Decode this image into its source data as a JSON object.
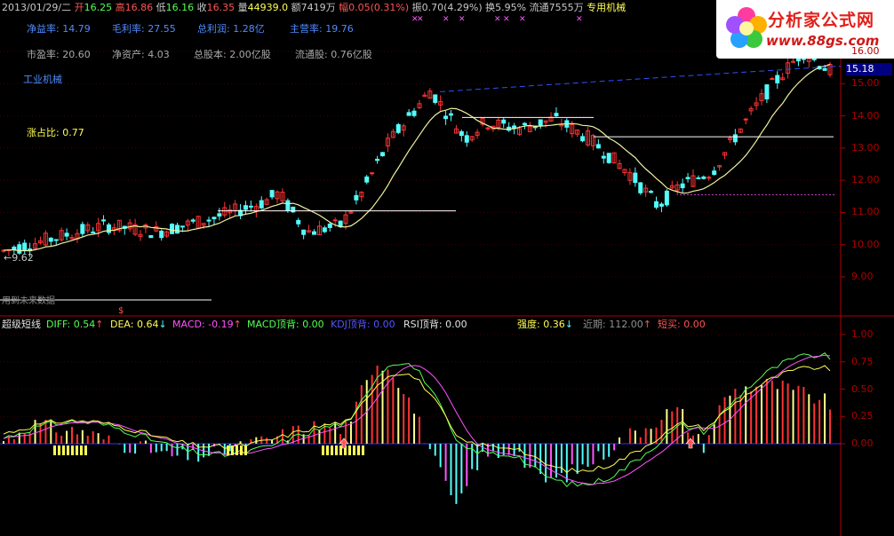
{
  "colors": {
    "up": "#ff3232",
    "down": "#54fcfc",
    "ma": "#f0f0a0",
    "axis": "#b00000",
    "label_white": "#c8c8c8",
    "label_blue": "#4f8cff",
    "label_yellow": "#ffff54",
    "label_red": "#ff5454",
    "label_green": "#54ff54",
    "label_magenta": "#ff54ff",
    "price_box": "#000080"
  },
  "header": {
    "date": "2013/01/29/二",
    "open_label": "开",
    "open": "16.25",
    "high_label": "高",
    "high": "16.86",
    "low_label": "低",
    "low": "16.16",
    "close_label": "收",
    "close": "16.35",
    "vol_label": "量",
    "vol": "44939.0",
    "amt_label": "额",
    "amt": "7419万",
    "chg_label": "幅",
    "chg": "0.05(0.31%)",
    "amp_label": "振",
    "amp": "0.70(4.29%)",
    "turn_label": "换",
    "turn": "5.95%",
    "float_label": "流通",
    "float": "7555万",
    "sector_text": "专用机械"
  },
  "fundamentals_row1": [
    {
      "label": "净益率:",
      "value": "14.79"
    },
    {
      "label": "毛利率:",
      "value": "27.55"
    },
    {
      "label": "总利润:",
      "value": "1.28亿"
    },
    {
      "label": "主营率:",
      "value": "19.76"
    }
  ],
  "fundamentals_row2": [
    {
      "label": "市盈率:",
      "value": "20.60"
    },
    {
      "label": "净资产:",
      "value": "4.03"
    },
    {
      "label": "总股本:",
      "value": "2.00亿股"
    },
    {
      "label": "流通股:",
      "value": "0.76亿股"
    }
  ],
  "industry": "工业机械",
  "up_ratio": {
    "label": "涨占比:",
    "value": "0.77"
  },
  "low_marker": "9.62",
  "future_data_label": "用到未来数据",
  "dollar_marker": "$",
  "current_price": "15.18",
  "price_axis": [
    "16.00",
    "15.00",
    "14.00",
    "13.00",
    "12.00",
    "11.00",
    "10.00",
    "9.00"
  ],
  "indicator_axis": [
    "1.00",
    "0.75",
    "0.50",
    "0.25",
    "0.00"
  ],
  "indicator": {
    "name": "超级短线",
    "items": [
      {
        "label": "DIFF:",
        "value": "0.54",
        "arrow": "↑",
        "color": "#54ff54"
      },
      {
        "label": "DEA:",
        "value": "0.64",
        "arrow": "↓",
        "color": "#ffff54"
      },
      {
        "label": "MACD:",
        "value": "-0.19",
        "arrow": "↑",
        "color": "#ff54ff"
      },
      {
        "label": "MACD顶背:",
        "value": "0.00",
        "arrow": "",
        "color": "#54ff54"
      },
      {
        "label": "KDJ顶背:",
        "value": "0.00",
        "arrow": "",
        "color": "#5454ff"
      },
      {
        "label": "RSI顶背:",
        "value": "0.00",
        "arrow": "",
        "color": "#e0e0e0"
      },
      {
        "label": "强度:",
        "value": "0.36",
        "arrow": "↓",
        "color": "#ffff54"
      },
      {
        "label": "近期:",
        "value": "112.00",
        "arrow": "↑",
        "color": "#909090"
      },
      {
        "label": "短买:",
        "value": "0.00",
        "arrow": "",
        "color": "#ff5454"
      }
    ]
  },
  "logo": {
    "name": "分析家公式网",
    "url": "www.88gs.com"
  }
}
